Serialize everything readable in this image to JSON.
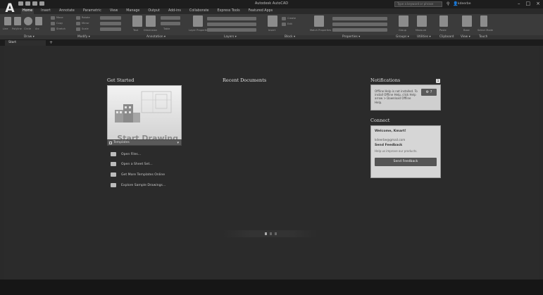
{
  "app": {
    "logo": "A",
    "title": "Autodesk AutoCAD"
  },
  "search": {
    "placeholder": "Type a keyword or phrase"
  },
  "user": {
    "name": "kdeerbe"
  },
  "window_controls": [
    "–",
    "□",
    "×"
  ],
  "ribbon_tabs": [
    "Home",
    "Insert",
    "Annotate",
    "Parametric",
    "View",
    "Manage",
    "Output",
    "Add-ins",
    "Collaborate",
    "Express Tools",
    "Featured Apps"
  ],
  "panel_titles": [
    "Draw ▾",
    "Modify ▾",
    "Annotation ▾",
    "Layers ▾",
    "Block ▾",
    "Properties ▾",
    "Groups ▾",
    "Utilities ▾",
    "Clipboard",
    "View ▾",
    "Touch"
  ],
  "ribbon_labels": {
    "line": "Line",
    "polyline": "Polyline",
    "circle": "Circle",
    "arc": "Arc",
    "move": "Move",
    "copy": "Copy",
    "stretch": "Stretch",
    "rotate": "Rotate",
    "mirror": "Mirror",
    "scale": "Scale",
    "text": "Text",
    "dimension": "Dimension",
    "table": "Table",
    "layer_properties": "Layer Properties",
    "insert": "Insert",
    "create": "Create",
    "edit": "Edit",
    "match_properties": "Match Properties",
    "group": "Group",
    "measure": "Measure",
    "paste": "Paste",
    "base": "Base",
    "select_mode": "Select Mode"
  },
  "doc_tabs": {
    "start": "Start",
    "add": "+"
  },
  "get_started": {
    "heading": "Get Started",
    "start_drawing": "Start Drawing",
    "templates": "Templates",
    "links": [
      {
        "label": "Open Files..."
      },
      {
        "label": "Open a Sheet Set..."
      },
      {
        "label": "Get More Templates Online"
      },
      {
        "label": "Explore Sample Drawings..."
      }
    ]
  },
  "recent_documents": {
    "heading": "Recent Documents"
  },
  "notifications": {
    "heading": "Notifications",
    "count": "1",
    "message": "Offline Help is not installed. To install Offline Help, click Help arrow > Download Offline Help.",
    "button": "?"
  },
  "connect": {
    "heading": "Connect",
    "welcome": "Welcome, Kmart!",
    "email": "kdeerbe@gmail.com",
    "feedback_title": "Send Feedback",
    "help_text": "Help us improve our products.",
    "feedback_button": "Send Feedback"
  },
  "pager": {
    "dots": 3,
    "active_index": 0
  },
  "colors": {
    "background": "#2a2a2a",
    "ribbon": "#3b3b3b",
    "card": "#d6d6d6",
    "button": "#555555"
  }
}
